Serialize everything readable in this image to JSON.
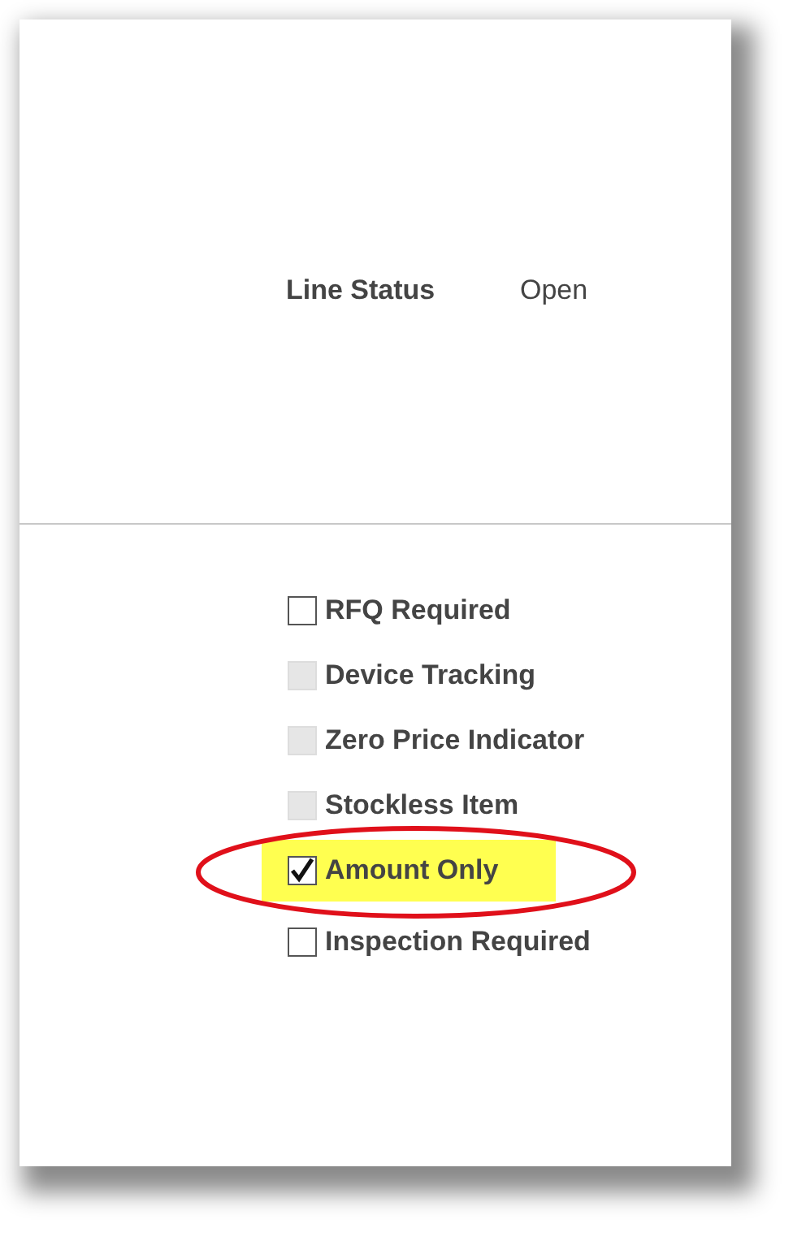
{
  "fields": [
    {
      "label": "Line Status",
      "value": "Open"
    }
  ],
  "options": [
    {
      "label": "RFQ Required",
      "checked": false,
      "disabled": false,
      "highlighted": false,
      "circled": false
    },
    {
      "label": "Device Tracking",
      "checked": false,
      "disabled": true,
      "highlighted": false,
      "circled": false
    },
    {
      "label": "Zero Price Indicator",
      "checked": false,
      "disabled": true,
      "highlighted": false,
      "circled": false
    },
    {
      "label": "Stockless Item",
      "checked": false,
      "disabled": true,
      "highlighted": false,
      "circled": false
    },
    {
      "label": "Amount Only",
      "checked": true,
      "disabled": false,
      "highlighted": true,
      "circled": true
    },
    {
      "label": "Inspection Required",
      "checked": false,
      "disabled": false,
      "highlighted": false,
      "circled": false
    }
  ]
}
